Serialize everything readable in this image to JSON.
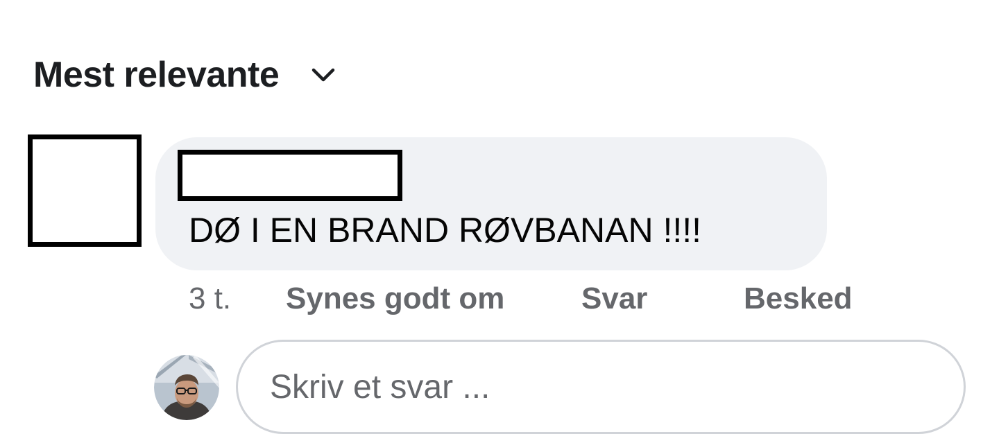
{
  "sort": {
    "label": "Mest relevante",
    "icon": "chevron-down-icon"
  },
  "comment": {
    "avatar": "redacted-box",
    "author_name": "redacted-box",
    "text": "DØ I EN BRAND RØVBANAN !!!!",
    "bubble_color": "#f0f2f5"
  },
  "actions": {
    "time": "3 t.",
    "like": "Synes godt om",
    "reply": "Svar",
    "message": "Besked"
  },
  "reply_box": {
    "placeholder": "Skriv et svar ...",
    "value": "",
    "user_avatar": "user-avatar-photo"
  },
  "colors": {
    "text_primary": "#050505",
    "text_secondary": "#65676b",
    "input_border": "#d0d3d8"
  }
}
